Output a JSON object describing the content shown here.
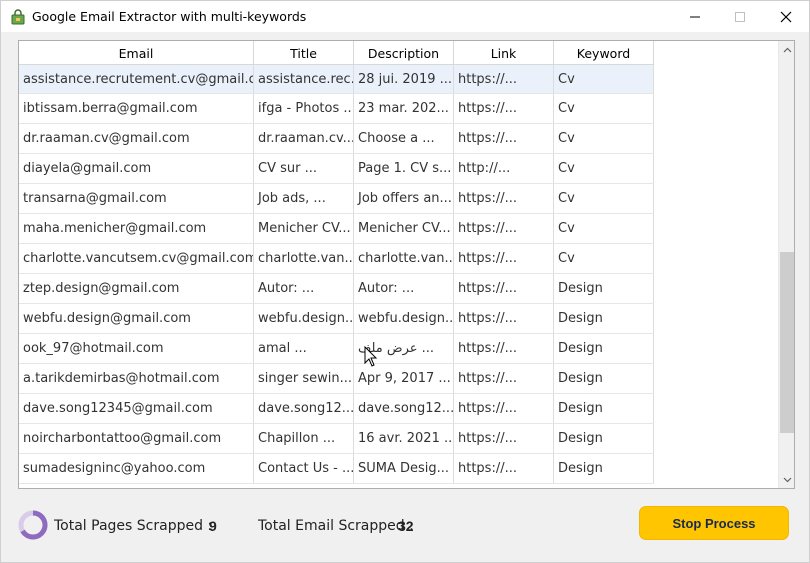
{
  "window": {
    "title": "Google Email Extractor with multi-keywords"
  },
  "grid": {
    "columns": [
      "Email",
      "Title",
      "Description",
      "Link",
      "Keyword"
    ],
    "rows": [
      [
        "assistance.recrutement.cv@gmail.c...",
        "assistance.rec...",
        "28 jui. 2019 ...",
        "https://...",
        "Cv"
      ],
      [
        "ibtissam.berra@gmail.com",
        "ifga - Photos ...",
        "23 mar. 202...",
        "https://...",
        "Cv"
      ],
      [
        "dr.raaman.cv@gmail.com",
        "dr.raaman.cv...",
        "Choose a ...",
        "https://...",
        "Cv"
      ],
      [
        "diayela@gmail.com",
        "CV sur ...",
        "Page 1. CV s...",
        "http://...",
        "Cv"
      ],
      [
        "transarna@gmail.com",
        "Job ads, ...",
        "Job offers an...",
        "https://...",
        "Cv"
      ],
      [
        "maha.menicher@gmail.com",
        "Menicher CV...",
        "Menicher CV...",
        "https://...",
        "Cv"
      ],
      [
        "charlotte.vancutsem.cv@gmail.com",
        "charlotte.van...",
        "charlotte.van...",
        "https://...",
        "Cv"
      ],
      [
        "ztep.design@gmail.com",
        "Autor: ...",
        "Autor: ...",
        "https://...",
        "Design"
      ],
      [
        "webfu.design@gmail.com",
        "webfu.design...",
        "webfu.design...",
        "https://...",
        "Design"
      ],
      [
        "ook_97@hotmail.com",
        "amal ...",
        "عرض ملف ...",
        "https://...",
        "Design"
      ],
      [
        "a.tarikdemirbas@hotmail.com",
        "singer sewin...",
        "Apr 9, 2017 ...",
        "https://...",
        "Design"
      ],
      [
        "dave.song12345@gmail.com",
        "dave.song12...",
        "dave.song12...",
        "https://...",
        "Design"
      ],
      [
        "noircharbontattoo@gmail.com",
        "Chapillon ...",
        "16 avr. 2021 ...",
        "https://...",
        "Design"
      ],
      [
        "sumadesigninc@yahoo.com",
        "Contact Us - ...",
        "SUMA Desig...",
        "https://...",
        "Design"
      ]
    ]
  },
  "footer": {
    "pages_label": "Total Pages Scrapped :",
    "pages_value": "9",
    "emails_label": "Total Email Scrapped :",
    "emails_value": "32",
    "stop_label": "Stop Process"
  },
  "colors": {
    "accent": "#ffc500",
    "spinner": "#8e6bbf"
  }
}
